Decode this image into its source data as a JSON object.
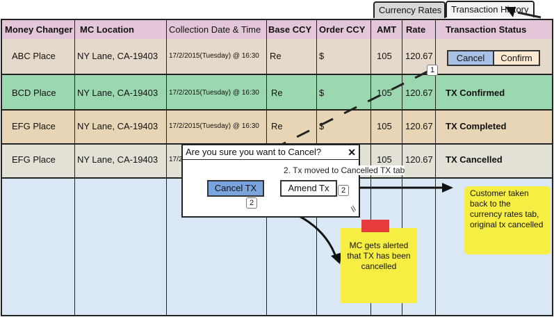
{
  "tabs": [
    "Currency Rates",
    "Transaction History"
  ],
  "headers": [
    "Money Changer",
    "MC Location",
    "Collection Date & Time",
    "Base CCY",
    "Order CCY",
    "AMT",
    "Rate",
    "Transaction Status"
  ],
  "rows": [
    {
      "changer": "ABC Place",
      "location": "NY Lane, CA-19403",
      "datetime": "17/2/2015(Tuesday) @ 16:30",
      "base": "Re",
      "order": "$",
      "amt": "105",
      "rate": "120.67",
      "status": ""
    },
    {
      "changer": "BCD Place",
      "location": "NY Lane, CA-19403",
      "datetime": "17/2/2015(Tuesday) @ 16:30",
      "base": "Re",
      "order": "$",
      "amt": "105",
      "rate": "120.67",
      "status": "TX Confirmed"
    },
    {
      "changer": "EFG Place",
      "location": "NY Lane, CA-19403",
      "datetime": "17/2/2015(Tuesday) @ 16:30",
      "base": "Re",
      "order": "$",
      "amt": "105",
      "rate": "120.67",
      "status": "TX Completed"
    },
    {
      "changer": "EFG Place",
      "location": "NY Lane, CA-19403",
      "datetime": "17/2",
      "base": "",
      "order": "",
      "amt": "105",
      "rate": "120.67",
      "status": "TX Cancelled"
    }
  ],
  "row_actions": {
    "cancel": "Cancel",
    "confirm": "Confirm"
  },
  "dialog": {
    "title": "Are you sure you want to Cancel?",
    "close": "✕",
    "cancel_tx": "Cancel TX",
    "amend_tx": "Amend Tx"
  },
  "annotations": {
    "badge1": "1",
    "badge2a": "2",
    "badge2b": "2",
    "tip_moved": "2. Tx moved to Cancelled TX tab"
  },
  "notes": {
    "customer": "Customer taken back to the currency rates tab, original tx cancelled",
    "mc": "MC gets alerted that TX has been cancelled"
  },
  "colors": {
    "header": "#e3c7d9",
    "row_confirmed": "#9bd8b0",
    "note": "#f7ee44"
  }
}
